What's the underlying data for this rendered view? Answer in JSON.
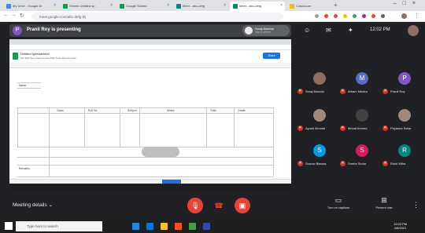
{
  "browser": {
    "tabs": [
      {
        "label": "My Drive - Google Dr",
        "color": "#4285f4"
      },
      {
        "label": "Sheets Untitled sp",
        "color": "#0f9d58"
      },
      {
        "label": "Google Sheets",
        "color": "#0f9d58"
      },
      {
        "label": "Meet - abc-defg",
        "color": "#00897b"
      },
      {
        "label": "Meet - abc-defg",
        "color": "#00897b"
      },
      {
        "label": "Classroom",
        "color": "#fbbc04"
      }
    ],
    "url": "meet.google.com/abc-defg-hij"
  },
  "meet": {
    "presenting_label": "Pranil Roy is presenting",
    "presenter_initial": "P",
    "you_name": "Suraj Mondal",
    "you_sub": "You & others",
    "clock": "12:02 PM",
    "participants": [
      {
        "name": "Suraj Mondal",
        "initial": "",
        "color": "#8d6e63"
      },
      {
        "name": "Atharv Mishra",
        "initial": "M",
        "color": "#5c6bc0"
      },
      {
        "name": "Pranil Roy",
        "initial": "P",
        "color": "#7e57c2"
      },
      {
        "name": "Ayush Mondal",
        "initial": "",
        "color": "#a1887f"
      },
      {
        "name": "Mrinal Ahmed",
        "initial": "",
        "color": "#424242"
      },
      {
        "name": "Priyanka Saha",
        "initial": "",
        "color": "#a1887f"
      },
      {
        "name": "Sourav Biswas",
        "initial": "S",
        "color": "#039be5"
      },
      {
        "name": "Sneha Sinha",
        "initial": "S",
        "color": "#d81b60"
      },
      {
        "name": "Ronit Mitra",
        "initial": "R",
        "color": "#00897b"
      }
    ],
    "meeting_details": "Meeting details",
    "controls": {
      "present_label": "Turn on captions",
      "present_now_label": "Present now"
    }
  },
  "shared": {
    "doc_title": "Untitled spreadsheet",
    "menu": "File Edit View Insert Format Data Tools Add-ons Help",
    "share_label": "Share",
    "cells": [
      "Name",
      "Class",
      "Roll No",
      "Subject",
      "Marks",
      "Total",
      "Grade",
      "Remarks"
    ]
  },
  "taskbar": {
    "search_placeholder": "Type here to search",
    "time": "12:02 PM",
    "date": "4/8/2021"
  },
  "colors": {
    "meet_bg": "#202124",
    "end_call": "#ea4335",
    "accent": "#1a73e8"
  }
}
